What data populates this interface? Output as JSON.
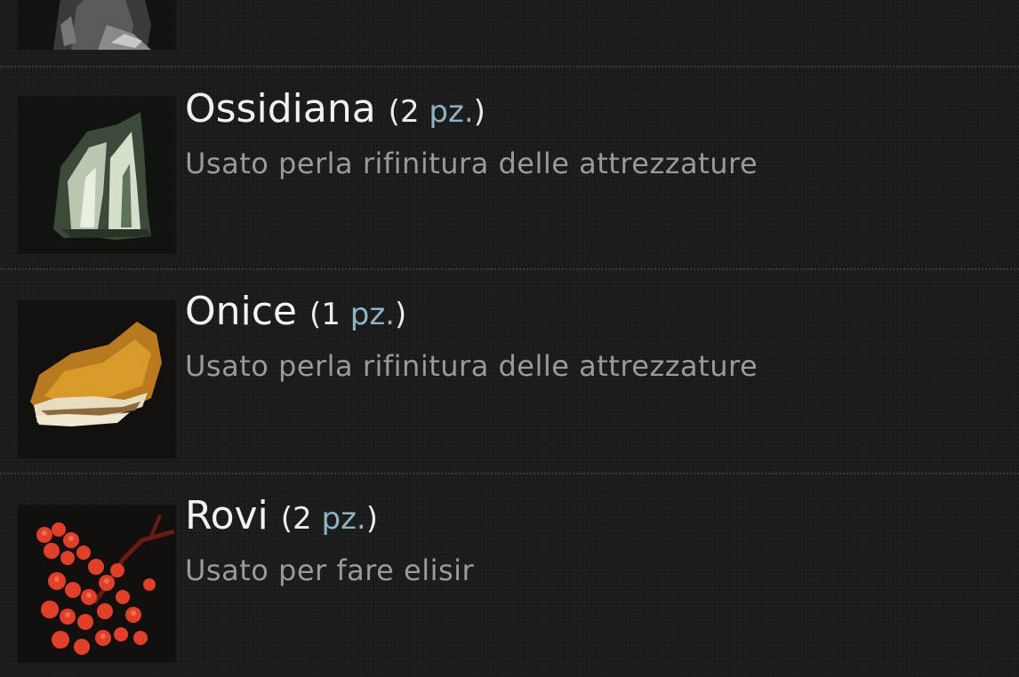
{
  "items": [
    {
      "name": "",
      "qty_open": "",
      "count": "",
      "unit": "",
      "qty_close": "",
      "description": "",
      "icon": "dark-stone-icon"
    },
    {
      "name": "Ossidiana",
      "qty_open": "(",
      "count": "2",
      "unit": "pz.",
      "qty_close": ")",
      "description": "Usato perla rifinitura delle attrezzature",
      "icon": "obsidian-icon"
    },
    {
      "name": "Onice",
      "qty_open": "(",
      "count": "1",
      "unit": "pz.",
      "qty_close": ")",
      "description": "Usato perla rifinitura delle attrezzature",
      "icon": "onyx-icon"
    },
    {
      "name": "Rovi",
      "qty_open": "(",
      "count": "2",
      "unit": "pz.",
      "qty_close": ")",
      "description": "Usato per fare elisir",
      "icon": "brambles-icon"
    }
  ],
  "colors": {
    "background": "#1c1c1c",
    "title": "#f2f2f2",
    "unit": "#8fb3c4",
    "description": "#9a9a9a"
  }
}
